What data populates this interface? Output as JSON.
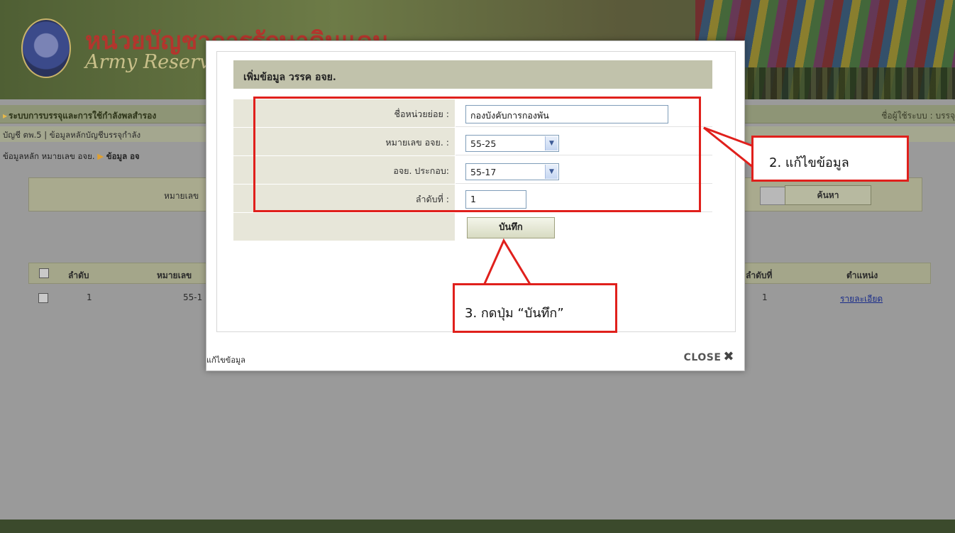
{
  "header": {
    "site_title_th": "หน่วยบัญชาการรักษาดินแดน",
    "site_title_en": "Army Reserve Command"
  },
  "menu": {
    "system_title": "ระบบการบรรจุและการใช้กำลังพลสำรอง",
    "user_label": "ชื่อผู้ใช้ระบบ : บรรจุ"
  },
  "submenu": {
    "text": "บัญชี ตพ.5 | ข้อมูลหลักบัญชีบรรจุกำลัง"
  },
  "breadcrumb": {
    "part1": "ข้อมูลหลัก หมายเลข อจย.",
    "part2": "ข้อมูล อจ"
  },
  "search": {
    "label": "หมายเลข",
    "button": "ค้นหา"
  },
  "table": {
    "headers": {
      "order": "ลำดับ",
      "number": "หมายเลข",
      "seq": "ลำดับที่",
      "position": "ตำแหน่ง"
    },
    "rows": [
      {
        "order": "1",
        "number": "55-1",
        "seq": "1",
        "position": "รายละเอียด"
      }
    ]
  },
  "modal": {
    "form_title": "เพิ่มข้อมูล วรรค อจย.",
    "fields": {
      "unit_name": {
        "label": "ชื่อหน่วยย่อย :",
        "value": "กองบังคับการกองพัน"
      },
      "ajy_number": {
        "label": "หมายเลข อจย. :",
        "value": "55-25"
      },
      "ajy_compose": {
        "label": "อจย. ประกอบ:",
        "value": "55-17"
      },
      "sequence": {
        "label": "ลำดับที่ :",
        "value": "1"
      }
    },
    "save_button": "บันทึก",
    "caption": "แก้ไขข้อมูล",
    "close_label": "CLOSE",
    "close_icon": "✖"
  },
  "annotations": {
    "step2": "2. แก้ไขข้อมูล",
    "step3": "3. กดปุ่ม “บันทึก”"
  },
  "colors": {
    "annotation_red": "#e0201c",
    "title_bar": "#c1c2ab",
    "label_cell": "#e7e6d9"
  }
}
